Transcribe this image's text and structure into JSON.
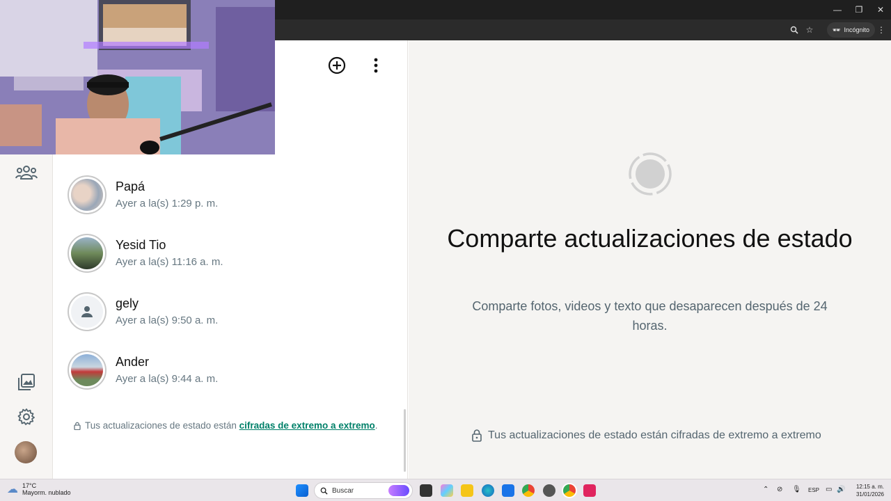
{
  "browser": {
    "incognito_label": "Incógnito"
  },
  "statuses": [
    {
      "name": "Papá",
      "time": "Ayer a la(s) 1:29 p. m."
    },
    {
      "name": "Yesid Tio",
      "time": "Ayer a la(s) 11:16 a. m."
    },
    {
      "name": "gely",
      "time": "Ayer a la(s) 9:50 a. m."
    },
    {
      "name": "Ander",
      "time": "Ayer a la(s) 9:44 a. m."
    }
  ],
  "panel_footer": {
    "prefix": "Tus actualizaciones de estado están ",
    "link": "cifradas de extremo a extremo",
    "suffix": "."
  },
  "main": {
    "title": "Comparte actualizaciones de estado",
    "subtitle": "Comparte fotos, videos y texto que desaparecen después de 24 horas.",
    "footer": "Tus actualizaciones de estado están cifradas de extremo a extremo"
  },
  "taskbar": {
    "weather_temp": "17°C",
    "weather_desc": "Mayorm. nublado",
    "search_placeholder": "Buscar",
    "language": "ESP",
    "time": "12:15 a. m.",
    "date": "31/01/2026"
  },
  "colors": {
    "accent": "#008069",
    "muted": "#667781"
  }
}
